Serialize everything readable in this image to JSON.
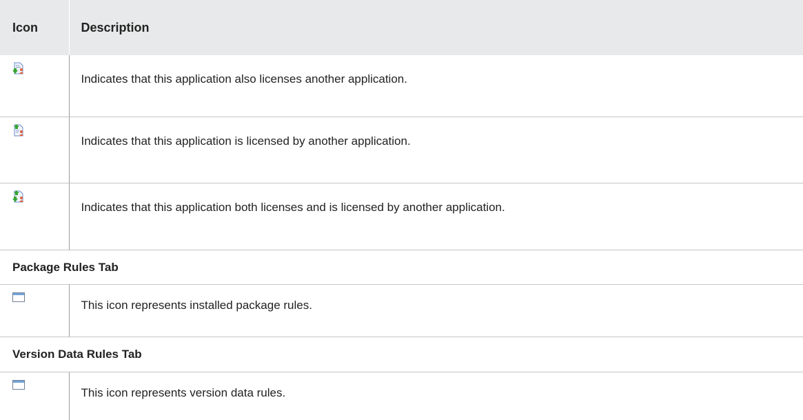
{
  "header": {
    "icon_label": "Icon",
    "description_label": "Description"
  },
  "rows": [
    {
      "icon": "licenses-another-app-icon",
      "description": "Indicates that this application also licenses another application."
    },
    {
      "icon": "licensed-by-another-app-icon",
      "description": "Indicates that this application is licensed by another application."
    },
    {
      "icon": "licenses-and-licensed-icon",
      "description": "Indicates that this application both licenses and is licensed by another application."
    }
  ],
  "sections": {
    "package_rules": {
      "title": "Package Rules Tab",
      "icon": "window-icon",
      "description": "This icon represents installed package rules."
    },
    "version_data_rules": {
      "title": "Version Data Rules Tab",
      "icon": "window-icon",
      "description": "This icon represents version data rules."
    }
  },
  "colors": {
    "header_bg": "#e8e9ea",
    "arrow_green": "#3aa435",
    "doc_blue": "#6f8fc7",
    "person_red": "#e0603c",
    "window_bar": "#74a6d8"
  }
}
